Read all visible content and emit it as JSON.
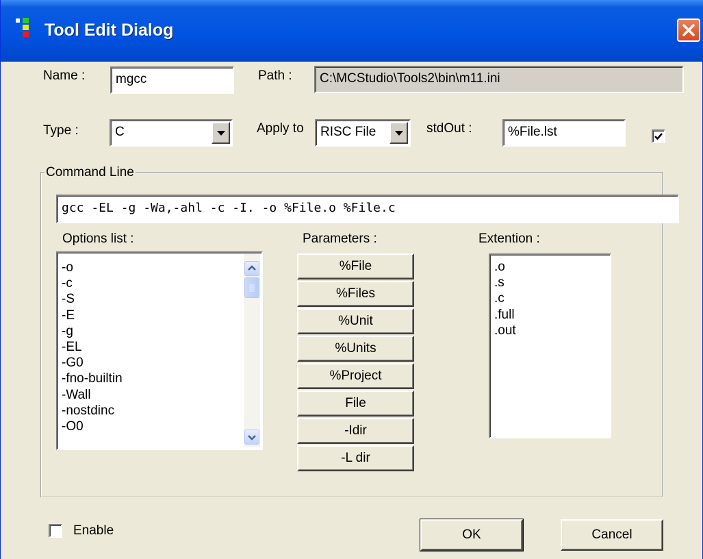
{
  "window": {
    "title": "Tool Edit Dialog"
  },
  "name": {
    "label": "Name :",
    "value": "mgcc"
  },
  "path": {
    "label": "Path :",
    "value": "C:\\MCStudio\\Tools2\\bin\\m11.ini"
  },
  "type": {
    "label": "Type :",
    "value": "C"
  },
  "apply_to": {
    "label": "Apply to",
    "value": "RISC File"
  },
  "stdout": {
    "label": "stdOut :",
    "value": "%File.lst",
    "checked": true
  },
  "command_line": {
    "legend": "Command Line",
    "value": "gcc -EL -g -Wa,-ahl -c -I. -o %File.o %File.c"
  },
  "options": {
    "label": "Options list :",
    "items": [
      "-o",
      "-c",
      "-S",
      "-E",
      "-g",
      "-EL",
      "-G0",
      "-fno-builtin",
      "-Wall",
      "-nostdinc",
      "-O0"
    ]
  },
  "parameters": {
    "label": "Parameters :",
    "buttons": [
      "%File",
      "%Files",
      "%Unit",
      "%Units",
      "%Project",
      "File",
      "-Idir",
      "-L dir"
    ]
  },
  "extension": {
    "label": "Extention :",
    "items": [
      ".o",
      ".s",
      ".c",
      ".full",
      ".out"
    ]
  },
  "enable": {
    "label": "Enable",
    "checked": false
  },
  "buttons": {
    "ok": "OK",
    "cancel": "Cancel"
  }
}
